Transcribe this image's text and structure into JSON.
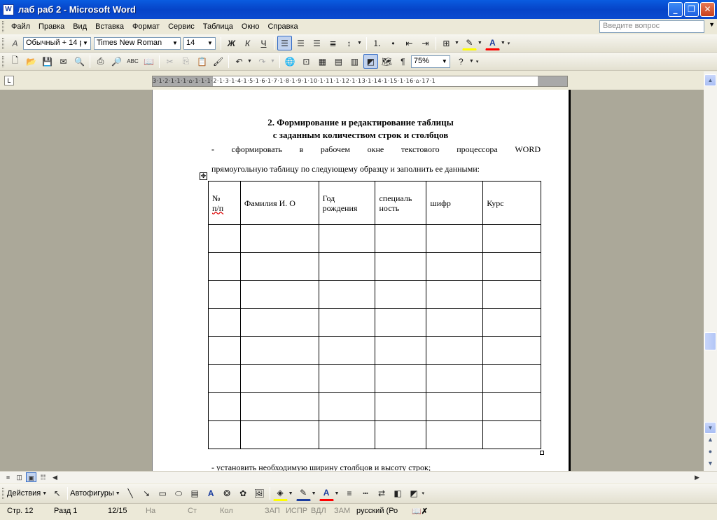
{
  "window": {
    "title": "лаб раб 2 - Microsoft Word",
    "app_icon": "W"
  },
  "menu": {
    "items": [
      "Файл",
      "Правка",
      "Вид",
      "Вставка",
      "Формат",
      "Сервис",
      "Таблица",
      "Окно",
      "Справка"
    ],
    "help_placeholder": "Введите вопрос"
  },
  "formatting": {
    "style": "Обычный + 14 р",
    "font": "Times New Roman",
    "size": "14"
  },
  "standard": {
    "zoom": "75%"
  },
  "ruler": {
    "numbers": "3·1·2·1·1·1·⌂·1·1·1·2·1·3·1·4·1·5·1·6·1·7·1·8·1·9·1·10·1·11·1·12·1·13·1·14·1·15·1·16·⌂·17·1"
  },
  "document": {
    "heading_line1": "2.  Формирование и редактирование таблицы",
    "heading_line2": "с заданным количеством строк и столбцов",
    "bullet": "-",
    "para1_words": [
      "сформировать",
      "в",
      "рабочем",
      "окне",
      "текстового",
      "процессора",
      "WORD"
    ],
    "para2": "прямоугольную таблицу по следующему образцу и заполнить ее данными:",
    "table_headers": [
      {
        "l1": "№",
        "l2": "п/п"
      },
      {
        "l1": "Фамилия И. О",
        "l2": ""
      },
      {
        "l1": "Год",
        "l2": "рождения"
      },
      {
        "l1": "специаль",
        "l2": "ность"
      },
      {
        "l1": "шифр",
        "l2": ""
      },
      {
        "l1": "Курс",
        "l2": ""
      }
    ],
    "table_empty_rows": 8,
    "para3": "- установить необходимую ширину столбцов и высоту строк;"
  },
  "drawing": {
    "actions": "Действия",
    "autoshapes": "Автофигуры"
  },
  "status": {
    "page": "Стр.  12",
    "section": "Разд  1",
    "pages": "12/15",
    "at": "На",
    "line": "Ст",
    "col": "Кол",
    "rec": "ЗАП",
    "trk": "ИСПР",
    "ext": "ВДЛ",
    "ovr": "ЗАМ",
    "lang": "русский (Ро"
  },
  "colors": {
    "title_bar": "#0a5ce0",
    "page_bg": "#aba899",
    "highlight": "#ffff00",
    "font_color": "#ff0000"
  }
}
